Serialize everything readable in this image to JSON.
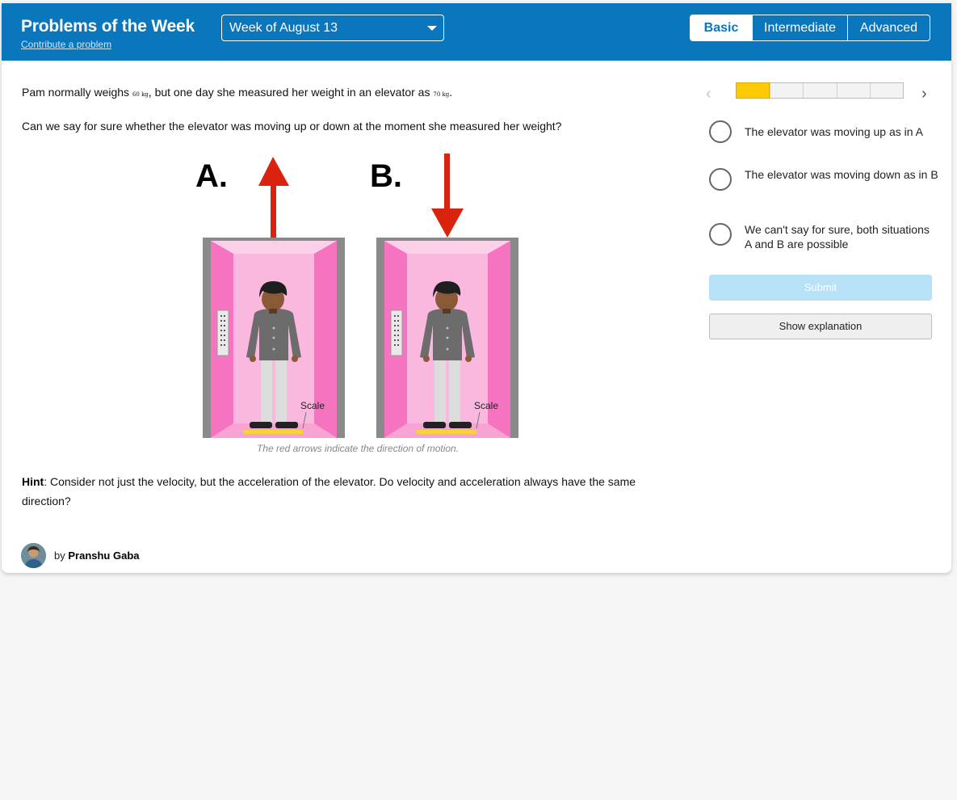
{
  "header": {
    "title": "Problems of the Week",
    "contribute_link": "Contribute a problem",
    "week_select_value": "Week of August 13",
    "levels": [
      "Basic",
      "Intermediate",
      "Advanced"
    ],
    "active_level": "Basic"
  },
  "problem": {
    "intro_before": "Pam normally weighs ",
    "weight_normal": "60 kg",
    "intro_middle": ", but one day she measured her weight in an elevator as ",
    "weight_elevator": "70 kg",
    "intro_after": ".",
    "question": "Can we say for sure whether the elevator was moving up or down at the moment she measured her weight?",
    "figure_labels": [
      "A.",
      "B."
    ],
    "scale_label": "Scale",
    "caption": "The red arrows indicate the direction of motion.",
    "hint_label": "Hint",
    "hint_text": ": Consider not just the velocity, but the acceleration of the elevator. Do velocity and acceleration always have the same direction?"
  },
  "author": {
    "by": "by",
    "name": "Pranshu Gaba"
  },
  "progress": {
    "segments": 5,
    "current": 1
  },
  "options": [
    "The elevator was moving up as in A",
    "The elevator was moving down as in B",
    "We can't say for sure, both situations A and B are possible"
  ],
  "buttons": {
    "submit": "Submit",
    "explanation": "Show explanation"
  },
  "colors": {
    "header": "#0a76bb",
    "progress_fill": "#ffc906",
    "arrow": "#d9230f",
    "elevator_pink": "#f673c0"
  }
}
